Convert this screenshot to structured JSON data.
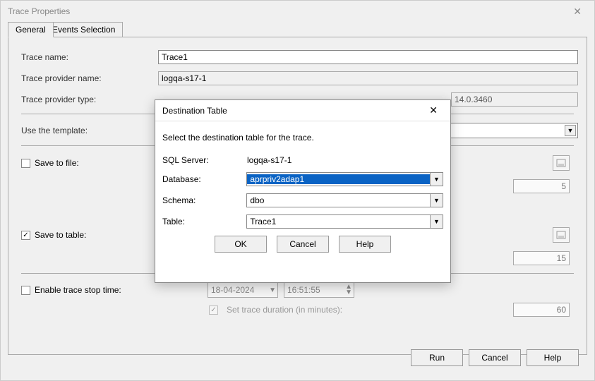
{
  "window": {
    "title": "Trace Properties",
    "tabs": {
      "general": "General",
      "events": "Events Selection"
    }
  },
  "general": {
    "trace_name_label": "Trace name:",
    "trace_name_value": "Trace1",
    "provider_name_label": "Trace provider name:",
    "provider_name_value": "logqa-s17-1",
    "provider_type_label": "Trace provider type:",
    "version_value": "14.0.3460",
    "use_template_label": "Use the template:",
    "save_to_file_label": "Save to file:",
    "save_to_file_num": "5",
    "save_to_table_label": "Save to table:",
    "save_to_table_num": "15",
    "enable_stop_label": "Enable trace stop time:",
    "stop_date": "18-04-2024",
    "stop_time": "16:51:55",
    "duration_label": "Set trace duration (in minutes):",
    "duration_value": "60"
  },
  "modal": {
    "title": "Destination Table",
    "desc": "Select the destination table for the trace.",
    "sql_server_label": "SQL Server:",
    "sql_server_value": "logqa-s17-1",
    "database_label": "Database:",
    "database_value": "aprpriv2adap1",
    "schema_label": "Schema:",
    "schema_value": "dbo",
    "table_label": "Table:",
    "table_value": "Trace1",
    "ok_label": "OK",
    "cancel_label": "Cancel",
    "help_label": "Help"
  },
  "footer": {
    "run_label": "Run",
    "cancel_label": "Cancel",
    "help_label": "Help"
  }
}
